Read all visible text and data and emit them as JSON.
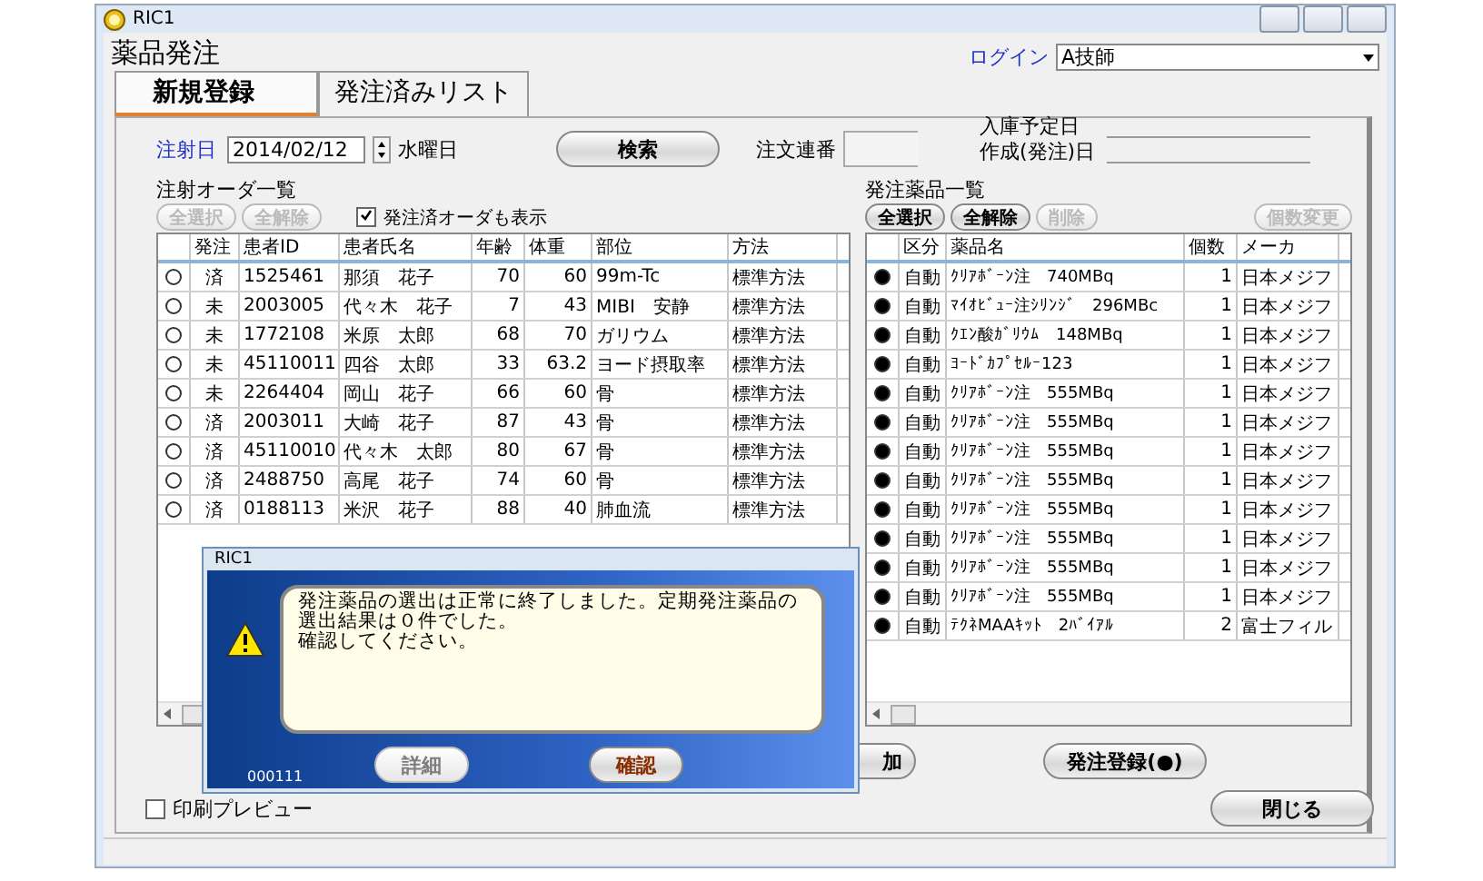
{
  "window": {
    "title": "RIC1",
    "app_title": "薬品発注"
  },
  "login": {
    "label": "ログイン",
    "value": "A技師"
  },
  "tabs": [
    {
      "label": "新規登録",
      "selected": true
    },
    {
      "label": "発注済みリスト",
      "selected": false
    }
  ],
  "search_bar": {
    "date_label": "注射日",
    "date": "2014/02/12",
    "weekday": "水曜日",
    "search_button": "検索",
    "order_no_label": "注文連番"
  },
  "dates": [
    {
      "label": "入庫予定日"
    },
    {
      "label": "作成(発注)日"
    }
  ],
  "order_list": {
    "title": "注射オーダ一覧",
    "buttons": [
      {
        "label": "全選択",
        "disabled": true
      },
      {
        "label": "全解除",
        "disabled": true
      }
    ],
    "show_done": {
      "label": "発注済オーダも表示",
      "checked": true
    },
    "columns": [
      {
        "label": "発注"
      },
      {
        "label": "患者ID"
      },
      {
        "label": "患者氏名"
      },
      {
        "label": "年齢"
      },
      {
        "label": "体重"
      },
      {
        "label": "部位"
      },
      {
        "label": "方法"
      }
    ],
    "rows": [
      {
        "selected": false,
        "cells": [
          "済",
          "1525461",
          "那須　花子",
          "70",
          "60",
          "99m-Tc",
          "標準方法"
        ]
      },
      {
        "selected": false,
        "cells": [
          "未",
          "2003005",
          "代々木　花子",
          "7",
          "43",
          "MIBI　安静",
          "標準方法"
        ]
      },
      {
        "selected": false,
        "cells": [
          "未",
          "1772108",
          "米原　太郎",
          "68",
          "70",
          "ガリウム",
          "標準方法"
        ]
      },
      {
        "selected": false,
        "cells": [
          "未",
          "45110011",
          "四谷　太郎",
          "33",
          "63.2",
          "ヨード摂取率",
          "標準方法"
        ]
      },
      {
        "selected": false,
        "cells": [
          "未",
          "2264404",
          "岡山　花子",
          "66",
          "60",
          "骨",
          "標準方法"
        ]
      },
      {
        "selected": false,
        "cells": [
          "済",
          "2003011",
          "大崎　花子",
          "87",
          "43",
          "骨",
          "標準方法"
        ]
      },
      {
        "selected": false,
        "cells": [
          "済",
          "45110010",
          "代々木　太郎",
          "80",
          "67",
          "骨",
          "標準方法"
        ]
      },
      {
        "selected": false,
        "cells": [
          "済",
          "2488750",
          "高尾　花子",
          "74",
          "60",
          "骨",
          "標準方法"
        ]
      },
      {
        "selected": false,
        "cells": [
          "済",
          "0188113",
          "米沢　花子",
          "88",
          "40",
          "肺血流",
          "標準方法"
        ]
      }
    ]
  },
  "drug_list": {
    "title": "発注薬品一覧",
    "buttons": [
      {
        "label": "全選択",
        "disabled": false
      },
      {
        "label": "全解除",
        "disabled": false
      },
      {
        "label": "削除",
        "disabled": true
      },
      {
        "label": "個数変更",
        "disabled": true
      }
    ],
    "columns": [
      {
        "label": "区分"
      },
      {
        "label": "薬品名"
      },
      {
        "label": "個数"
      },
      {
        "label": "メーカ"
      }
    ],
    "rows": [
      {
        "selected": true,
        "cells": [
          "自動",
          "ｸﾘｱﾎﾞｰﾝ注　740MBq",
          "1",
          "日本メジフ"
        ]
      },
      {
        "selected": true,
        "cells": [
          "自動",
          "ﾏｲｵﾋﾞｭｰ注ｼﾘﾝｼﾞ　296MBc",
          "1",
          "日本メジフ"
        ]
      },
      {
        "selected": true,
        "cells": [
          "自動",
          "ｸｴﾝ酸ｶﾞﾘｳﾑ　148MBq",
          "1",
          "日本メジフ"
        ]
      },
      {
        "selected": true,
        "cells": [
          "自動",
          "ﾖｰﾄﾞｶﾌﾟｾﾙｰ123",
          "1",
          "日本メジフ"
        ]
      },
      {
        "selected": true,
        "cells": [
          "自動",
          "ｸﾘｱﾎﾞｰﾝ注　555MBq",
          "1",
          "日本メジフ"
        ]
      },
      {
        "selected": true,
        "cells": [
          "自動",
          "ｸﾘｱﾎﾞｰﾝ注　555MBq",
          "1",
          "日本メジフ"
        ]
      },
      {
        "selected": true,
        "cells": [
          "自動",
          "ｸﾘｱﾎﾞｰﾝ注　555MBq",
          "1",
          "日本メジフ"
        ]
      },
      {
        "selected": true,
        "cells": [
          "自動",
          "ｸﾘｱﾎﾞｰﾝ注　555MBq",
          "1",
          "日本メジフ"
        ]
      },
      {
        "selected": true,
        "cells": [
          "自動",
          "ｸﾘｱﾎﾞｰﾝ注　555MBq",
          "1",
          "日本メジフ"
        ]
      },
      {
        "selected": true,
        "cells": [
          "自動",
          "ｸﾘｱﾎﾞｰﾝ注　555MBq",
          "1",
          "日本メジフ"
        ]
      },
      {
        "selected": true,
        "cells": [
          "自動",
          "ｸﾘｱﾎﾞｰﾝ注　555MBq",
          "1",
          "日本メジフ"
        ]
      },
      {
        "selected": true,
        "cells": [
          "自動",
          "ｸﾘｱﾎﾞｰﾝ注　555MBq",
          "1",
          "日本メジフ"
        ]
      },
      {
        "selected": true,
        "cells": [
          "自動",
          "ﾃｸﾈMAAｷｯﾄ　2ﾊﾞｲｱﾙ",
          "2",
          "富士フィル"
        ]
      }
    ]
  },
  "footer_buttons": [
    {
      "label": "加"
    },
    {
      "label": "発注登録(●)"
    }
  ],
  "close_button": "閉じる",
  "print_preview": {
    "label": "印刷プレビュー",
    "checked": false
  },
  "dialog": {
    "title": "RIC1",
    "message": [
      "発注薬品の選出は正常に終了しました。定期発注薬品の選出結果は０件でした。",
      "確認してください。"
    ],
    "code": "000111",
    "buttons": [
      {
        "label": "詳細",
        "disabled": true
      },
      {
        "label": "確認",
        "disabled": false
      }
    ]
  }
}
